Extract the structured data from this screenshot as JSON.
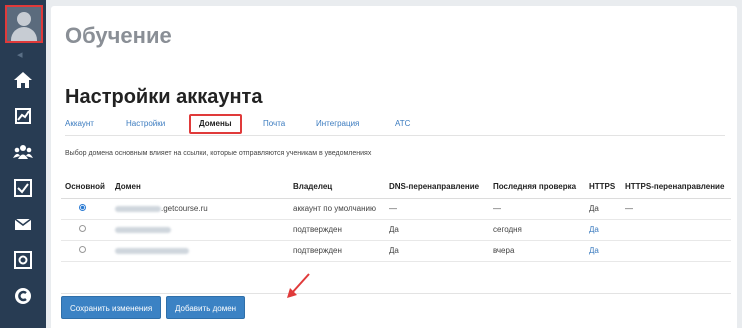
{
  "sidebar": {
    "collapse_glyph": "◂",
    "items": [
      {
        "icon": "home-icon"
      },
      {
        "icon": "chart-icon"
      },
      {
        "icon": "users-icon"
      },
      {
        "icon": "tasks-checkbox-icon"
      },
      {
        "icon": "mail-icon"
      },
      {
        "icon": "safe-icon"
      },
      {
        "icon": "chat-icon"
      }
    ]
  },
  "header": {
    "top_title": "Обучение",
    "page_title": "Настройки аккаунта"
  },
  "tabs": [
    {
      "label": "Аккаунт"
    },
    {
      "label": "Настройки"
    },
    {
      "label": "Домены",
      "active": true
    },
    {
      "label": "Почта"
    },
    {
      "label": "Интеграция"
    },
    {
      "label": "АТС"
    }
  ],
  "hint": "Выбор домена основным влияет на ссылки, которые отправляются ученикам в уведомлениях",
  "table": {
    "columns": [
      "Основной",
      "Домен",
      "Владелец",
      "DNS-перенаправление",
      "Последняя проверка",
      "HTTPS",
      "HTTPS-перенаправление"
    ],
    "rows": [
      {
        "primary": true,
        "domain_suffix": ".getcourse.ru",
        "owner": "аккаунт по умолчанию",
        "dns": "—",
        "last_check": "—",
        "https": "Да",
        "https_redirect": "—"
      },
      {
        "primary": false,
        "domain_suffix": "",
        "owner": "подтвержден",
        "dns": "Да",
        "last_check": "сегодня",
        "https": "Да",
        "https_redirect": ""
      },
      {
        "primary": false,
        "domain_suffix": "",
        "owner": "подтвержден",
        "dns": "Да",
        "last_check": "вчера",
        "https": "Да",
        "https_redirect": ""
      }
    ]
  },
  "buttons": {
    "save": "Сохранить изменения",
    "add_domain": "Добавить домен"
  },
  "colors": {
    "sidebar_bg": "#283c53",
    "accent": "#3b82c4",
    "highlight": "#e03a3a"
  }
}
